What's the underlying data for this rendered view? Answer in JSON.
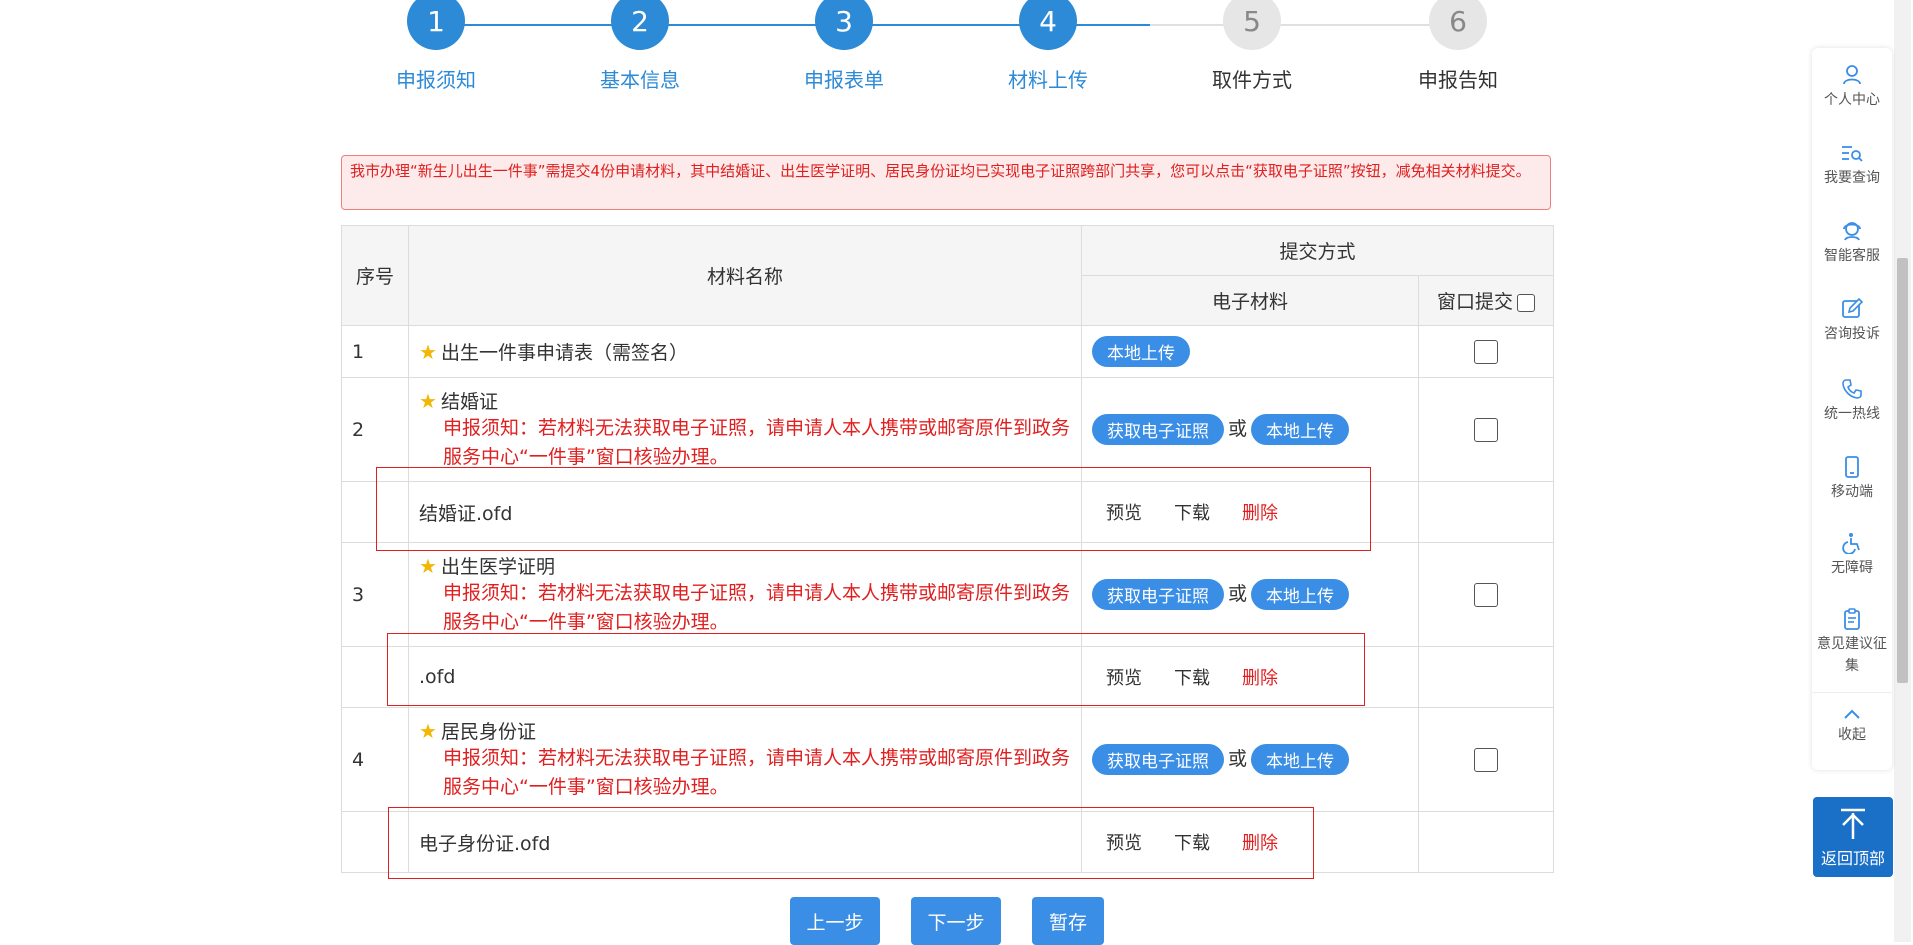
{
  "stepper": {
    "steps": [
      {
        "num": "1",
        "label": "申报须知",
        "state": "done"
      },
      {
        "num": "2",
        "label": "基本信息",
        "state": "done"
      },
      {
        "num": "3",
        "label": "申报表单",
        "state": "done"
      },
      {
        "num": "4",
        "label": "材料上传",
        "state": "done"
      },
      {
        "num": "5",
        "label": "取件方式",
        "state": "todo"
      },
      {
        "num": "6",
        "label": "申报告知",
        "state": "todo"
      }
    ]
  },
  "notice": "我市办理“新生儿出生一件事”需提交4份申请材料，其中结婚证、出生医学证明、居民身份证均已实现电子证照跨部门共享，您可以点击“获取电子证照”按钮，减免相关材料提交。",
  "table": {
    "headers": {
      "no": "序号",
      "name": "材料名称",
      "submit": "提交方式",
      "electronic": "电子材料",
      "window": "窗口提交"
    },
    "note_text": "申报须知：若材料无法获取电子证照，请申请人本人携带或邮寄原件到政务服务中心“一件事”窗口核验办理。",
    "materials": [
      {
        "no": "1",
        "name": "出生一件事申请表（需签名）"
      },
      {
        "no": "2",
        "name": "结婚证",
        "file": "结婚证.ofd"
      },
      {
        "no": "3",
        "name": "出生医学证明",
        "file": ".ofd"
      },
      {
        "no": "4",
        "name": "居民身份证",
        "file": "电子身份证.ofd"
      }
    ],
    "btn_get_license": "获取电子证照",
    "btn_local_upload": "本地上传",
    "or_text": "或",
    "action_preview": "预览",
    "action_download": "下载",
    "action_delete": "删除"
  },
  "buttons": {
    "prev": "上一步",
    "next": "下一步",
    "save": "暂存"
  },
  "sidebar": {
    "items": [
      {
        "label": "个人中心",
        "icon": "user-icon"
      },
      {
        "label": "我要查询",
        "icon": "search-list-icon"
      },
      {
        "label": "智能客服",
        "icon": "service-icon"
      },
      {
        "label": "咨询投诉",
        "icon": "edit-icon"
      },
      {
        "label": "统一热线",
        "icon": "phone-icon"
      },
      {
        "label": "移动端",
        "icon": "mobile-icon"
      },
      {
        "label": "无障碍",
        "icon": "accessibility-icon"
      },
      {
        "label": "意见建议征集",
        "icon": "clipboard-icon"
      }
    ],
    "collapse": "收起",
    "back_top": "返回顶部"
  },
  "colors": {
    "accent": "#2c8ad6",
    "button": "#3a8ee6",
    "danger": "#e02020",
    "inactive": "#e6e6e6"
  }
}
